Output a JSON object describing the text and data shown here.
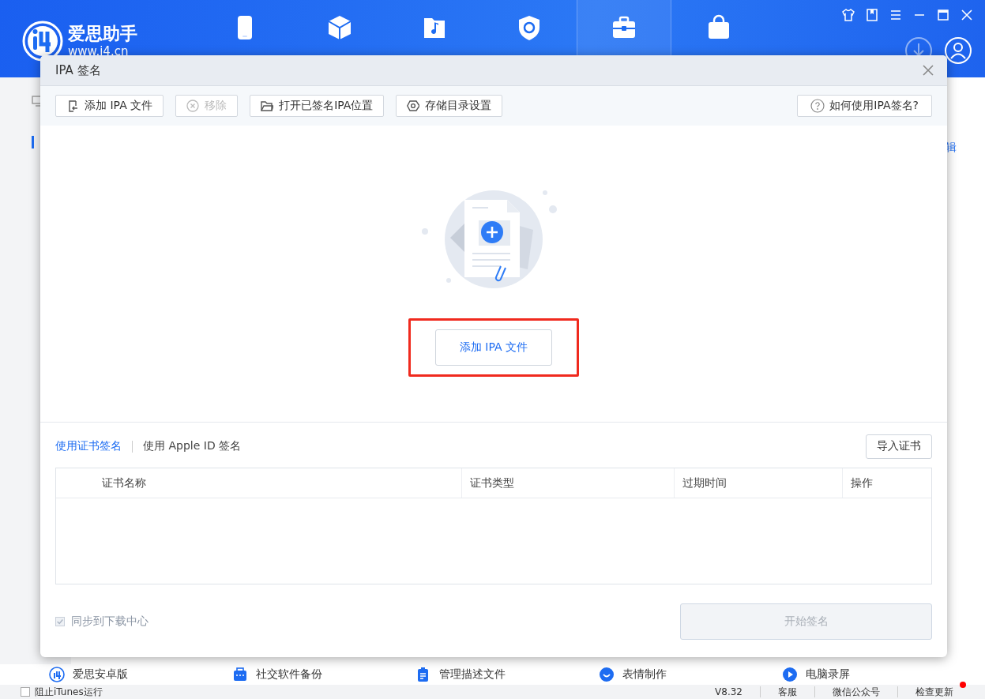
{
  "app": {
    "logo_name": "爱思助手",
    "logo_url": "www.i4.cn",
    "nav": [
      {
        "selected": false
      },
      {
        "selected": false
      },
      {
        "selected": false
      },
      {
        "selected": false
      },
      {
        "selected": true
      },
      {
        "selected": false
      }
    ],
    "side_fragment": "辑"
  },
  "dialog": {
    "title": "IPA 签名",
    "toolbar": [
      {
        "label": "添加 IPA 文件",
        "disabled": false
      },
      {
        "label": "移除",
        "disabled": true
      },
      {
        "label": "打开已签名IPA位置",
        "disabled": false
      },
      {
        "label": "存储目录设置",
        "disabled": false
      }
    ],
    "help_button": "如何使用IPA签名?",
    "add_button": "添加 IPA 文件",
    "sign_tabs": [
      {
        "label": "使用证书签名",
        "selected": true
      },
      {
        "label": "使用 Apple ID 签名",
        "selected": false
      }
    ],
    "import_button": "导入证书",
    "table": {
      "columns": [
        "证书名称",
        "证书类型",
        "过期时间",
        "操作"
      ]
    },
    "sync": {
      "label": "同步到下载中心",
      "checked": true,
      "disabled": true
    },
    "start_button": {
      "label": "开始签名",
      "disabled": true
    }
  },
  "shortcuts": [
    {
      "label": "爱思安卓版"
    },
    {
      "label": "社交软件备份"
    },
    {
      "label": "管理描述文件"
    },
    {
      "label": "表情制作"
    },
    {
      "label": "电脑录屏"
    }
  ],
  "status_bar": {
    "itunes": {
      "label": "阻止iTunes运行",
      "checked": false
    },
    "version": "V8.32",
    "links": [
      "客服",
      "微信公众号",
      "检查更新"
    ],
    "update_dot": true
  }
}
